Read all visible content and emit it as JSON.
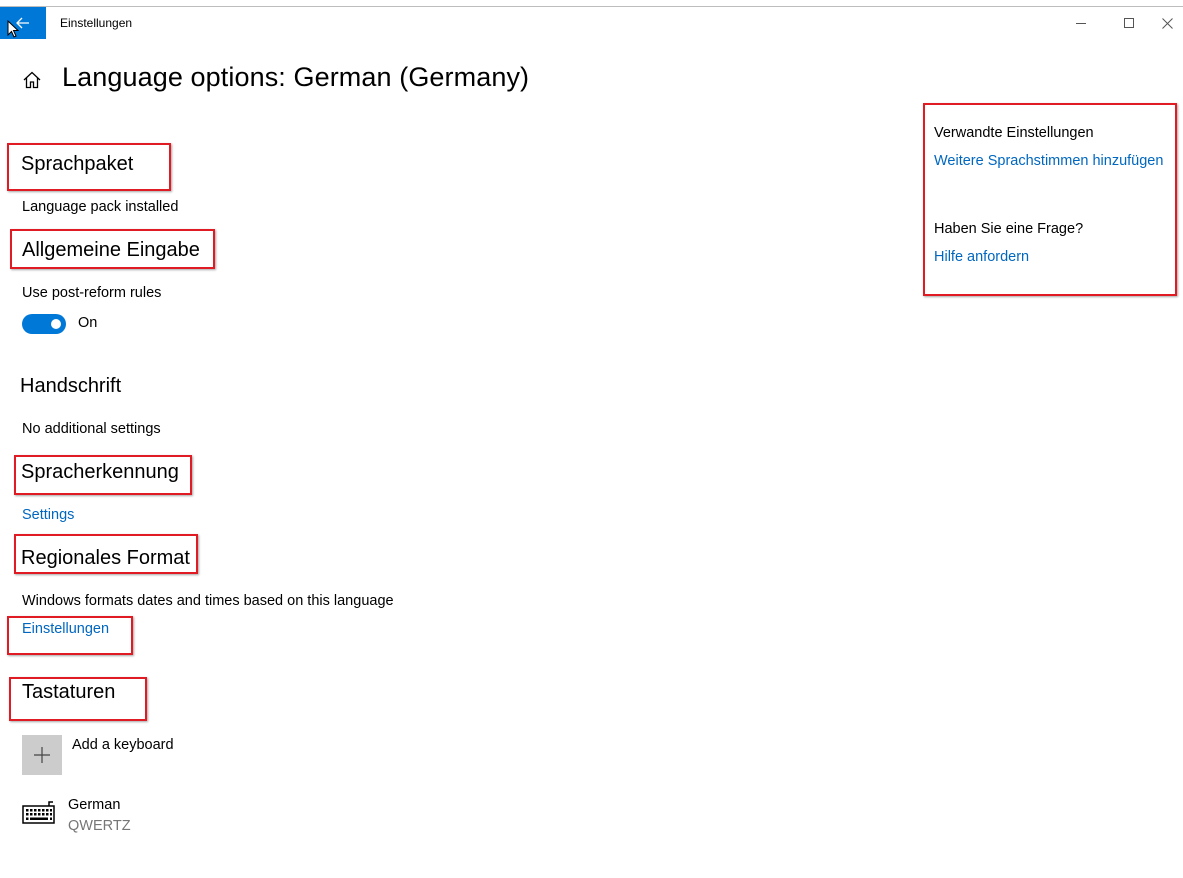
{
  "window": {
    "app_title": "Einstellungen",
    "back_icon": "arrow-left-icon",
    "controls": [
      "minimize-icon",
      "maximize-icon",
      "close-icon"
    ]
  },
  "header": {
    "title": "Language options: German (Germany)"
  },
  "sections": {
    "language_pack": {
      "heading": "Sprachpaket",
      "status": "Language pack installed"
    },
    "general_input": {
      "heading": "Allgemeine Eingabe",
      "option_label": "Use post-reform rules",
      "toggle_state": "On",
      "toggle_on": true
    },
    "handwriting": {
      "heading": "Handschrift",
      "status": "No additional settings"
    },
    "speech": {
      "heading": "Spracherkennung",
      "link": "Settings"
    },
    "regional_format": {
      "heading": "Regionales Format",
      "description": "Windows formats dates and times based on this language",
      "link": "Einstellungen"
    },
    "keyboards": {
      "heading": "Tastaturen",
      "add_label": "Add a keyboard",
      "items": [
        {
          "name": "German",
          "layout": "QWERTZ",
          "icon": "keyboard-icon"
        }
      ]
    }
  },
  "related": {
    "heading": "Verwandte Einstellungen",
    "link": "Weitere Sprachstimmen hinzufügen",
    "question": "Haben Sie eine Frage?",
    "help_link": "Hilfe anfordern"
  },
  "colors": {
    "accent": "#0078d7",
    "link": "#0067c0",
    "highlight_box": "#e01b24"
  }
}
